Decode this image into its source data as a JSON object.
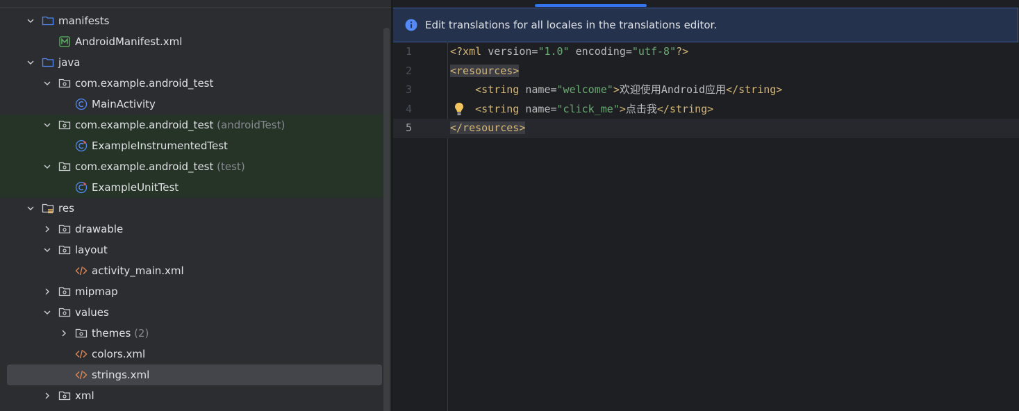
{
  "tree": [
    {
      "label": "manifests",
      "icon": "folder-blue-icon",
      "chevron": "down",
      "indent": 0
    },
    {
      "label": "AndroidManifest.xml",
      "icon": "manifest-file-icon",
      "chevron": "none",
      "indent": 1
    },
    {
      "label": "java",
      "icon": "folder-blue-icon",
      "chevron": "down",
      "indent": 0
    },
    {
      "label": "com.example.android_test",
      "icon": "package-icon",
      "chevron": "down",
      "indent": 1
    },
    {
      "label": "MainActivity",
      "icon": "class-icon",
      "chevron": "none",
      "indent": 2
    },
    {
      "label": "com.example.android_test",
      "suffix": "(androidTest)",
      "icon": "package-icon",
      "chevron": "down",
      "indent": 1,
      "test": true
    },
    {
      "label": "ExampleInstrumentedTest",
      "icon": "test-class-icon",
      "chevron": "none",
      "indent": 2,
      "test": true
    },
    {
      "label": "com.example.android_test",
      "suffix": "(test)",
      "icon": "package-icon",
      "chevron": "down",
      "indent": 1,
      "test": true
    },
    {
      "label": "ExampleUnitTest",
      "icon": "test-class-icon",
      "chevron": "none",
      "indent": 2,
      "test": true
    },
    {
      "label": "res",
      "icon": "res-folder-icon",
      "chevron": "down",
      "indent": 0
    },
    {
      "label": "drawable",
      "icon": "package-icon",
      "chevron": "right",
      "indent": 1
    },
    {
      "label": "layout",
      "icon": "package-icon",
      "chevron": "down",
      "indent": 1
    },
    {
      "label": "activity_main.xml",
      "icon": "xml-file-icon",
      "chevron": "none",
      "indent": 2
    },
    {
      "label": "mipmap",
      "icon": "package-icon",
      "chevron": "right",
      "indent": 1
    },
    {
      "label": "values",
      "icon": "package-icon",
      "chevron": "down",
      "indent": 1
    },
    {
      "label": "themes",
      "suffix": "(2)",
      "icon": "package-icon",
      "chevron": "right",
      "indent": 2
    },
    {
      "label": "colors.xml",
      "icon": "xml-file-icon",
      "chevron": "none",
      "indent": 2
    },
    {
      "label": "strings.xml",
      "icon": "xml-file-icon",
      "chevron": "none",
      "indent": 2,
      "selected": true
    },
    {
      "label": "xml",
      "icon": "package-icon",
      "chevron": "right",
      "indent": 1
    }
  ],
  "editor": {
    "banner": {
      "text": "Edit translations for all locales in the translations editor.",
      "icon": "info-icon"
    },
    "line_numbers": [
      "1",
      "2",
      "3",
      "4",
      "5"
    ],
    "current_line": 5,
    "code": {
      "l1": {
        "open": "<?xml ",
        "a1": "version=",
        "v1": "\"1.0\"",
        "sp": " ",
        "a2": "encoding=",
        "v2": "\"utf-8\"",
        "close": "?>"
      },
      "l2": {
        "tag": "<resources>"
      },
      "l3": {
        "indent": "    ",
        "open": "<string ",
        "attr": "name=",
        "val": "\"welcome\"",
        "gt": ">",
        "text": "欢迎使用Android应用",
        "close": "</string>"
      },
      "l4": {
        "indent": "    ",
        "open": "<string ",
        "attr": "name=",
        "val": "\"click_me\"",
        "gt": ">",
        "text": "点击我",
        "close": "</string>"
      },
      "l5": {
        "tag": "</resources>"
      }
    }
  },
  "colors": {
    "accent": "#3574f0",
    "folder": "#548af7",
    "xml_icon": "#e08855",
    "class_icon": "#548af7",
    "string_value": "#6aab73",
    "tag": "#d5b778"
  }
}
